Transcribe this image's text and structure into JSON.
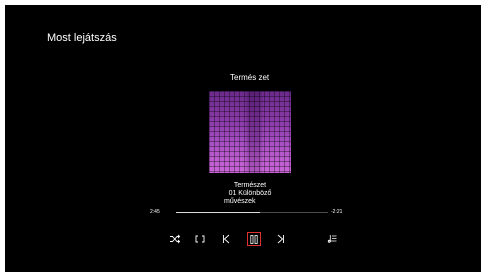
{
  "header": {
    "title": "Most lejátszás"
  },
  "album": {
    "label": "Termés zet"
  },
  "track": {
    "title": "Természet",
    "subtitle": "01 Különböző",
    "artist": "művészek"
  },
  "playback": {
    "elapsed": "2:45",
    "remaining": "-2:21",
    "progress_fraction": 0.55
  },
  "controls": {
    "shuffle": "shuffle-icon",
    "repeat": "repeat-icon",
    "previous": "previous-icon",
    "play_pause": "pause-icon",
    "next": "next-icon",
    "queue": "queue-icon"
  },
  "colors": {
    "background": "#000000",
    "text": "#ffffff",
    "focus": "#e03030",
    "album_tint": "#a24cc0"
  }
}
